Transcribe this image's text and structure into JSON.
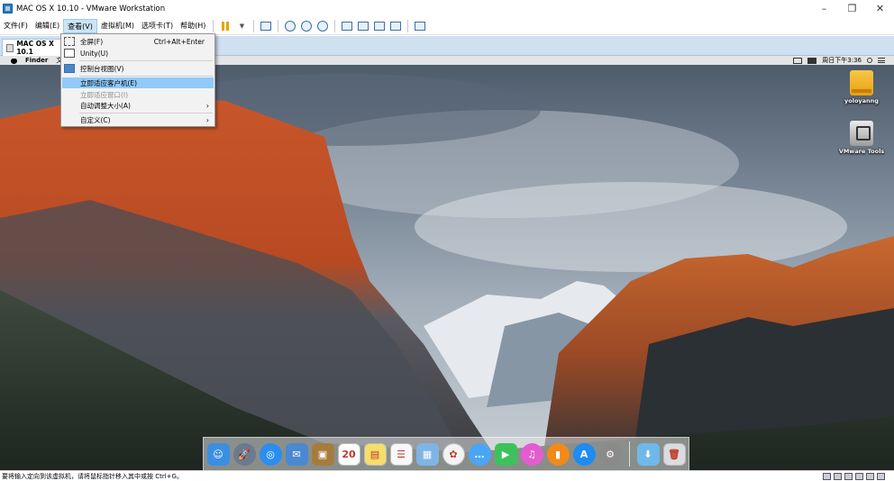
{
  "window": {
    "title": "MAC OS X 10.10 - VMware Workstation",
    "controls": {
      "minimize": "–",
      "maximize": "❐",
      "close": "✕"
    }
  },
  "menubar": {
    "items": [
      "文件(F)",
      "编辑(E)",
      "查看(V)",
      "虚拟机(M)",
      "选项卡(T)",
      "帮助(H)"
    ],
    "active_index": 2
  },
  "tab": {
    "label": "MAC OS X 10.1"
  },
  "view_menu": {
    "items": [
      {
        "label": "全屏(F)",
        "shortcut": "Ctrl+Alt+Enter",
        "icon": "fullscreen-icon"
      },
      {
        "label": "Unity(U)",
        "icon": "unity-icon"
      },
      {
        "label": "控制台视图(V)",
        "icon": "console-view-icon"
      },
      {
        "label": "立即适应客户机(E)",
        "highlighted": true
      },
      {
        "label": "立即适应窗口(I)",
        "disabled": true
      },
      {
        "label": "自动调整大小(A)",
        "submenu": true
      },
      {
        "label": "自定义(C)",
        "submenu": true
      }
    ]
  },
  "mac": {
    "app_name": "Finder",
    "menu_partial": "文",
    "clock": "周日下午3:36",
    "desktop_icons": [
      {
        "label": "yoloyanng",
        "icon": "hard-drive-icon"
      },
      {
        "label": "VMware Tools",
        "icon": "vmware-tools-disk-icon"
      }
    ],
    "dock_apps": [
      {
        "name": "finder-icon",
        "glyph": "☺",
        "color": "#3b8fe2"
      },
      {
        "name": "launchpad-icon",
        "glyph": "🚀",
        "color": "#6b7a8c"
      },
      {
        "name": "safari-icon",
        "glyph": "◎",
        "color": "#2a8ef0"
      },
      {
        "name": "mail-icon",
        "glyph": "✉",
        "color": "#4c88d0"
      },
      {
        "name": "contacts-icon",
        "glyph": "▣",
        "color": "#a67c3d"
      },
      {
        "name": "calendar-icon",
        "glyph": "20",
        "color": "#ffffff"
      },
      {
        "name": "notes-icon",
        "glyph": "▤",
        "color": "#f5de6a"
      },
      {
        "name": "reminders-icon",
        "glyph": "☰",
        "color": "#f8f8f8"
      },
      {
        "name": "preview-icon",
        "glyph": "▦",
        "color": "#7fb4e6"
      },
      {
        "name": "photos-icon",
        "glyph": "✿",
        "color": "#f3f3f3"
      },
      {
        "name": "messages-icon",
        "glyph": "…",
        "color": "#4aa6f5"
      },
      {
        "name": "facetime-icon",
        "glyph": "▶",
        "color": "#3cc25b"
      },
      {
        "name": "itunes-icon",
        "glyph": "♫",
        "color": "#e35dd0"
      },
      {
        "name": "ibooks-icon",
        "glyph": "▮",
        "color": "#f08a1c"
      },
      {
        "name": "app-store-icon",
        "glyph": "A",
        "color": "#1e8cf0"
      },
      {
        "name": "system-preferences-icon",
        "glyph": "⚙",
        "color": "#8a8a8a"
      },
      {
        "name": "downloads-folder-icon",
        "glyph": "⬇",
        "color": "#6fb8ea"
      },
      {
        "name": "trash-icon",
        "glyph": "🗑",
        "color": "#d9dde0"
      }
    ]
  },
  "statusbar": {
    "text": "要将输入定向到该虚拟机，请将鼠标指针移入其中或按 Ctrl+G。"
  }
}
